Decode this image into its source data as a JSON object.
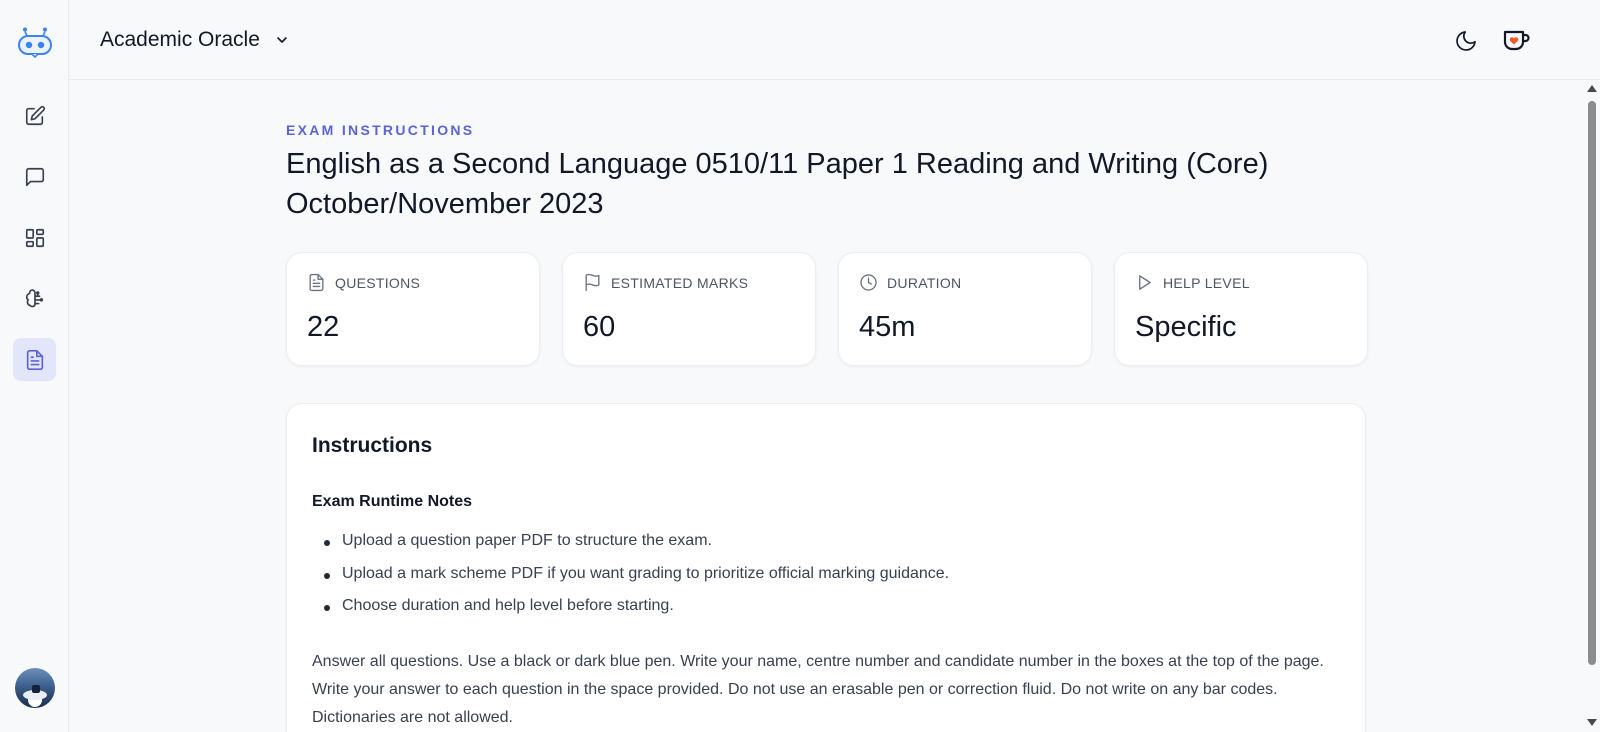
{
  "header": {
    "app_name": "Academic Oracle"
  },
  "sidebar": {
    "items": [
      {
        "name": "new-note",
        "icon": "pencil-square-icon"
      },
      {
        "name": "chat",
        "icon": "message-square-icon"
      },
      {
        "name": "dashboard",
        "icon": "grid-icon"
      },
      {
        "name": "brain",
        "icon": "brain-icon"
      },
      {
        "name": "exam",
        "icon": "document-icon",
        "active": true
      }
    ]
  },
  "exam": {
    "eyebrow": "EXAM INSTRUCTIONS",
    "title": "English as a Second Language 0510/11 Paper 1 Reading and Writing (Core) October/November 2023",
    "stats": [
      {
        "label": "QUESTIONS",
        "value": "22",
        "icon": "document-icon"
      },
      {
        "label": "ESTIMATED MARKS",
        "value": "60",
        "icon": "flag-icon"
      },
      {
        "label": "DURATION",
        "value": "45m",
        "icon": "clock-icon"
      },
      {
        "label": "HELP LEVEL",
        "value": "Specific",
        "icon": "play-icon"
      }
    ]
  },
  "instructions": {
    "title": "Instructions",
    "notes_heading": "Exam Runtime Notes",
    "notes": [
      "Upload a question paper PDF to structure the exam.",
      "Upload a mark scheme PDF if you want grading to prioritize official marking guidance.",
      "Choose duration and help level before starting."
    ],
    "paragraph": "Answer all questions. Use a black or dark blue pen. Write your name, centre number and candidate number in the boxes at the top of the page. Write your answer to each question in the space provided. Do not use an erasable pen or correction fluid. Do not write on any bar codes. Dictionaries are not allowed."
  },
  "colors": {
    "accent": "#5b64d6",
    "active_bg": "#e3e6fa",
    "heart": "#f05a28"
  }
}
